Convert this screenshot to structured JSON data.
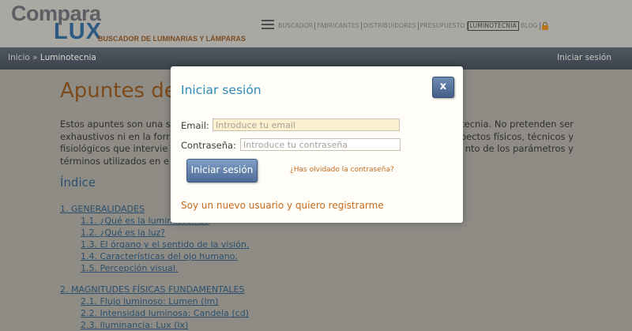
{
  "logo": {
    "word1": "Compara",
    "word2": "LUX",
    "tagline": "BUSCADOR DE LUMINARIAS Y LÁMPARAS"
  },
  "nav": {
    "items": [
      {
        "label": "BUSCADOR"
      },
      {
        "label": "FABRICANTES"
      },
      {
        "label": "DISTRIBUIDORES"
      },
      {
        "label": "PRESUPUESTO"
      },
      {
        "label": "LUMINOTECNIA"
      },
      {
        "label": "BLOG"
      }
    ]
  },
  "breadcrumb": {
    "home": "Inicio",
    "separator": "»",
    "current": "Luminotecnia"
  },
  "login_link": "Iniciar sesión",
  "page": {
    "title": "Apuntes de l",
    "intro_lines": [
      {
        "left": "Estos apuntes son una s",
        "right": "tecnia. No pretenden ser"
      },
      {
        "left": "exhaustivos ni en la forr",
        "right": "pectos físicos, técnicos y"
      },
      {
        "left": "fisiológicos que intervie",
        "right": "nto de los parámetros y"
      },
      {
        "left": "términos utilizados en e",
        "right": ""
      }
    ],
    "index_title": "Índice",
    "toc": [
      {
        "label": "1. GENERALIDADES",
        "items": [
          "1.1. ¿Qué es la luminotecnia?",
          "1.2. ¿Qué es la luz?",
          "1.3. El órgano y el sentido de la visión.",
          "1.4. Características del ojo humano.",
          "1.5. Percepción visual."
        ]
      },
      {
        "label": "2. MAGNITUDES FÍSICAS FUNDAMENTALES",
        "items": [
          "2.1. Flujo luminoso: Lumen (lm)",
          "2.2. Intensidad luminosa: Candela (cd)",
          "2.3. Iluminancia: Lux (lx)"
        ]
      }
    ]
  },
  "modal": {
    "title": "Iniciar sesión",
    "close_label": "x",
    "email_label": "Email:",
    "email_placeholder": "Introduce tu email",
    "email_value": "",
    "password_label": "Contraseña:",
    "password_placeholder": "Introduce tu contraseña",
    "password_value": "",
    "submit_label": "Iniciar sesión",
    "forgot_label": "¿Has olvidado la contraseña?",
    "register_label": "Soy un nuevo usuario y quiero registrarme"
  },
  "colors": {
    "accent_blue": "#2e8ab7",
    "link_orange": "#c66b1e",
    "button_blue": "#4e6c96"
  },
  "icons": {
    "menu": "hamburger-menu-icon",
    "lock": "lock-icon"
  }
}
